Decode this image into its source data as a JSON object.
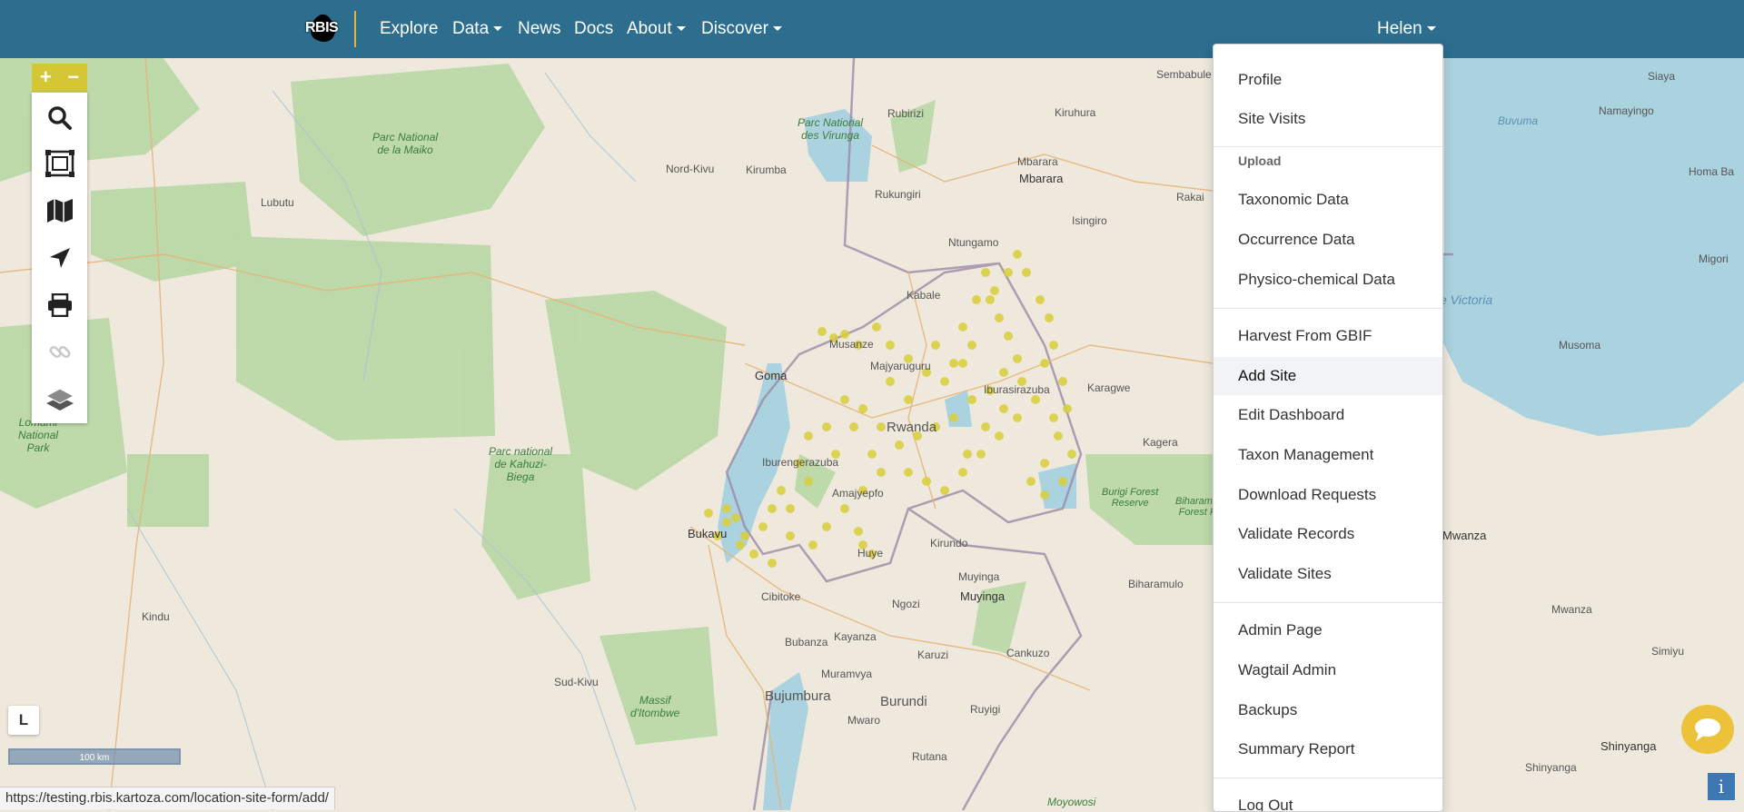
{
  "navbar": {
    "brand": "RBIS",
    "items": [
      {
        "label": "Explore",
        "dropdown": false
      },
      {
        "label": "Data",
        "dropdown": true
      },
      {
        "label": "News",
        "dropdown": false
      },
      {
        "label": "Docs",
        "dropdown": false
      },
      {
        "label": "About",
        "dropdown": true
      },
      {
        "label": "Discover",
        "dropdown": true
      }
    ],
    "user": "Helen"
  },
  "toolbar": {
    "zoom_in": "+",
    "zoom_out": "−",
    "tools": [
      "search-icon",
      "zoom-extent-icon",
      "map-icon",
      "locate-arrow-icon",
      "print-icon",
      "link-icon",
      "layers-icon"
    ]
  },
  "user_menu": {
    "items": [
      {
        "label": "Profile"
      },
      {
        "label": "Site Visits"
      },
      {
        "header": "Upload"
      },
      {
        "label": "Taxonomic Data"
      },
      {
        "label": "Occurrence Data"
      },
      {
        "label": "Physico-chemical Data"
      },
      {
        "label": "Harvest From GBIF"
      },
      {
        "label": "Add Site",
        "active": true
      },
      {
        "label": "Edit Dashboard"
      },
      {
        "label": "Taxon Management"
      },
      {
        "label": "Download Requests"
      },
      {
        "label": "Validate Records"
      },
      {
        "label": "Validate Sites"
      },
      {
        "label": "Admin Page"
      },
      {
        "label": "Wagtail Admin"
      },
      {
        "label": "Backups"
      },
      {
        "label": "Summary Report"
      },
      {
        "label": "Log Out"
      }
    ]
  },
  "map": {
    "labels": {
      "parc_maiko": "Parc National\nde la Maiko",
      "parc_virunga": "Parc National\ndes Virunga",
      "lubutu": "Lubutu",
      "nord_kivu": "Nord-Kivu",
      "kirumba": "Kirumba",
      "rubirizi": "Rubirizi",
      "kiruhura": "Kiruhura",
      "sembabule": "Sembabule",
      "mbarara_region": "Mbarara",
      "mbarara_city": "Mbarara",
      "isingiro": "Isingiro",
      "rukungiri": "Rukungiri",
      "rakai": "Rakai",
      "ntungamo": "Ntungamo",
      "kabale": "Kabale",
      "musanze": "Musanze",
      "majyaruguru": "Majyaruguru",
      "goma": "Goma",
      "iburasirazuba": "Iburasirazuba",
      "karagwe": "Karagwe",
      "rwanda": "Rwanda",
      "iburengerazuba": "Iburengerazuba",
      "amajyepfo": "Amajyepfo",
      "kahuzi": "Parc national\nde Kahuzi-\nBiega",
      "lomami": "Lomami\nNational\nPark",
      "kagera": "Kagera",
      "burigi": "Burigi Forest\nReserve",
      "biharamulo_res": "Biharamulo\nForest Re",
      "bukavu": "Bukavu",
      "kirundo": "Kirundo",
      "huye": "Huye",
      "biharamulo": "Biharamulo",
      "muyinga_region": "Muyinga",
      "muyinga": "Muyinga",
      "kindu": "Kindu",
      "cibitoke": "Cibitoke",
      "ngozi": "Ngozi",
      "kayanza": "Kayanza",
      "karuzi": "Karuzi",
      "cankuzo": "Cankuzo",
      "bubanza": "Bubanza",
      "muramvya": "Muramvya",
      "bujumbura": "Bujumbura",
      "burundi": "Burundi",
      "ruyigi": "Ruyigi",
      "sud_kivu": "Sud-Kivu",
      "itombwe": "Massif\nd'Itombwe",
      "mwaro": "Mwaro",
      "rutana": "Rutana",
      "siaya": "Siaya",
      "buvuma": "Buvuma",
      "namayingo": "Namayingo",
      "homa_bay": "Homa Ba",
      "migori": "Migori",
      "victoria": "e Victoria",
      "musoma": "Musoma",
      "mwanza_city": "Mwanza",
      "mwanza_region": "Mwanza",
      "simiyu": "Simiyu",
      "shinyanga": "Shinyanga",
      "moyowosi": "Moyowosi"
    },
    "lubutu_l": "L",
    "scale": "100 km"
  },
  "status_url": "https://testing.rbis.kartoza.com/location-site-form/add/",
  "info_button": "i",
  "colors": {
    "navbar": "#2d6d8e",
    "accent": "#d4c635",
    "points": "#d7cf3a"
  }
}
